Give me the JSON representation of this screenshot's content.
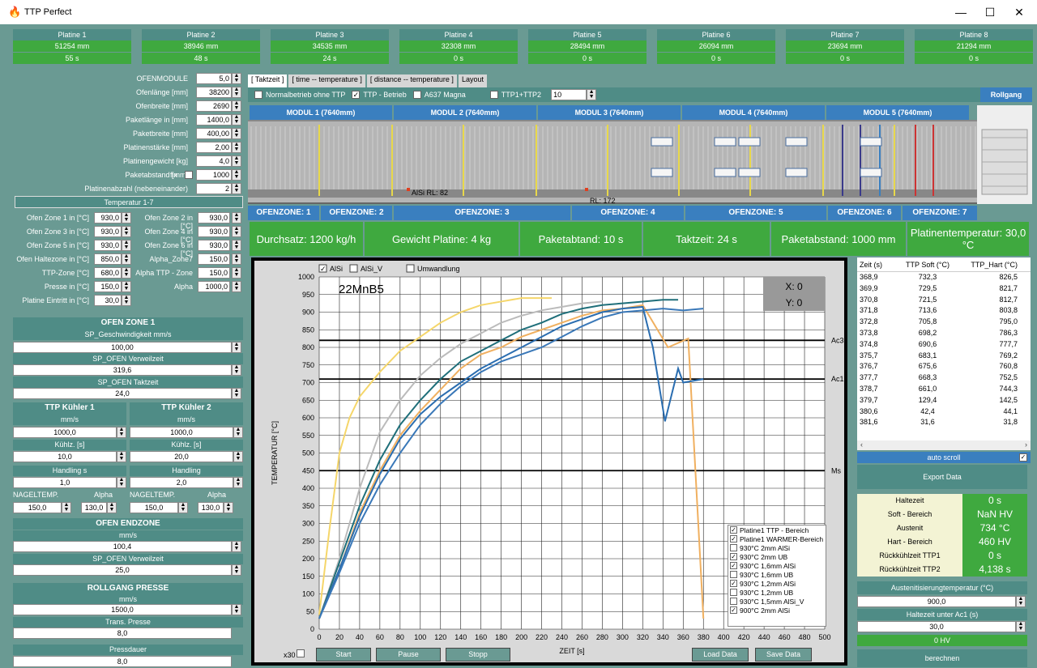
{
  "window": {
    "title": "TTP Perfect",
    "minimize": "—",
    "maximize": "☐",
    "close": "✕"
  },
  "platinen": [
    {
      "name": "Platine 1",
      "mm": "51254 mm",
      "s": "55 s"
    },
    {
      "name": "Platine 2",
      "mm": "38946 mm",
      "s": "48 s"
    },
    {
      "name": "Platine 3",
      "mm": "34535 mm",
      "s": "24 s"
    },
    {
      "name": "Platine 4",
      "mm": "32308 mm",
      "s": "0 s"
    },
    {
      "name": "Platine 5",
      "mm": "28494 mm",
      "s": "0 s"
    },
    {
      "name": "Platine 6",
      "mm": "26094 mm",
      "s": "0 s"
    },
    {
      "name": "Platine 7",
      "mm": "23694 mm",
      "s": "0 s"
    },
    {
      "name": "Platine 8",
      "mm": "21294 mm",
      "s": "0 s"
    }
  ],
  "ofen": [
    {
      "label": "OFENMODULE",
      "value": "5,0"
    },
    {
      "label": "Ofenlänge [mm]",
      "value": "38200"
    },
    {
      "label": "Ofenbreite [mm]",
      "value": "2690"
    },
    {
      "label": "Paketlänge in [mm]",
      "value": "1400,0"
    },
    {
      "label": "Paketbreite [mm]",
      "value": "400,00"
    },
    {
      "label": "Platinenstärke [mm]",
      "value": "2,00"
    },
    {
      "label": "Platinengewicht [kg]",
      "value": "4,0"
    },
    {
      "label": "Paketabstand [mm]",
      "value": "1000",
      "fix": "fix"
    },
    {
      "label": "Platinenabzahl (nebeneinander)",
      "value": "2"
    }
  ],
  "temperatur_hdr": "Temperatur 1-7",
  "zonen_links": [
    {
      "label": "Ofen Zone 1 in [°C]",
      "value": "930,0"
    },
    {
      "label": "Ofen Zone 3 in [°C]",
      "value": "930,0"
    },
    {
      "label": "Ofen Zone 5 in [°C]",
      "value": "930,0"
    },
    {
      "label": "Ofen Haltezone in [°C]",
      "value": "850,0"
    },
    {
      "label": "TTP-Zone [°C]",
      "value": "680,0"
    },
    {
      "label": "Presse in [°C]",
      "value": "150,0"
    },
    {
      "label": "Platine Eintritt in [°C]",
      "value": "30,0"
    }
  ],
  "zonen_rechts": [
    {
      "label": "Ofen Zone 2 in [°C]",
      "value": "930,0"
    },
    {
      "label": "Ofen Zone 4 in [°C]",
      "value": "930,0"
    },
    {
      "label": "Ofen Zone 6 in [°C]",
      "value": "930,0"
    },
    {
      "label": "Alpha_Zone7",
      "value": "150,0"
    },
    {
      "label": "Alpha TTP - Zone",
      "value": "150,0"
    },
    {
      "label": "Alpha",
      "value": "1000,0"
    }
  ],
  "ofen_zone1": {
    "title": "OFEN ZONE 1",
    "sp_geschw": "SP_Geschwindigkeit mm/s",
    "geschw": "100,00",
    "sp_verweil": "SP_OFEN Verweilzeit",
    "verweil": "319,6",
    "sp_takt": "SP_OFEN Taktzeit",
    "takt": "24,0"
  },
  "kuehler1": {
    "title": "TTP Kühler 1",
    "unit": "mm/s",
    "speed": "1000,0",
    "kuehlz_lbl": "Kühlz. [s]",
    "kuehlz": "10,0",
    "handling_lbl": "Handling s",
    "handling": "1,0"
  },
  "kuehler2": {
    "title": "TTP Kühler 2",
    "unit": "mm/s",
    "speed": "1000,0",
    "kuehlz_lbl": "Kühlz. [s]",
    "kuehlz": "20,0",
    "handling_lbl": "Handling",
    "handling": "2,0"
  },
  "nagel": {
    "nt_lbl": "NAGELTEMP.",
    "alpha_lbl": "Alpha",
    "nt1": "150,0",
    "a1": "130,0",
    "nt2": "150,0",
    "a2": "130,0"
  },
  "ofen_endzone": {
    "title": "OFEN ENDZONE",
    "unit": "mm/s",
    "speed": "100,4",
    "sp_verweil": "SP_OFEN Verweilzeit",
    "verweil": "25,0"
  },
  "rollgang_presse": {
    "title": "ROLLGANG PRESSE",
    "unit": "mm/s",
    "speed": "1500,0",
    "trans_lbl": "Trans. Presse",
    "trans": "8,0",
    "press_lbl": "Pressdauer",
    "press": "8,0"
  },
  "tabs": [
    "[ Taktzeit ]",
    "[ time -- temperature ]",
    "[ distance -- temperature ]",
    "Layout"
  ],
  "opts": {
    "normal": "Normalbetrieb ohne TTP",
    "ttp": "TTP - Betrieb",
    "a637": "A637 Magna",
    "ttp12": "TTP1+TTP2",
    "count": "10",
    "rollgang": "Rollgang"
  },
  "module": [
    "MODUL 1 (7640mm)",
    "MODUL 2 (7640mm)",
    "MODUL 3 (7640mm)",
    "MODUL 4 (7640mm)",
    "MODUL 5 (7640mm)"
  ],
  "markers": {
    "alsi": "AlSi RL: 82",
    "rl": "RL: 172"
  },
  "zones": [
    "OFENZONE: 1",
    "OFENZONE: 2",
    "OFENZONE: 3",
    "OFENZONE: 4",
    "OFENZONE: 5",
    "OFENZONE: 6",
    "OFENZONE: 7"
  ],
  "kpi": [
    "Durchsatz: 1200 kg/h",
    "Gewicht Platine: 4 kg",
    "Paketabtand: 10 s",
    "Taktzeit: 24 s",
    "Paketabstand: 1000 mm",
    "Platinentemperatur: 30,0 °C"
  ],
  "chart_data": {
    "type": "line",
    "title": "22MnB5",
    "xlabel": "ZEIT [s]",
    "ylabel": "TEMPERATUR [°C]",
    "xlim": [
      0,
      500
    ],
    "ylim": [
      0,
      1000
    ],
    "xticks": [
      0,
      20,
      40,
      60,
      80,
      100,
      120,
      140,
      160,
      180,
      200,
      220,
      240,
      260,
      280,
      300,
      320,
      340,
      360,
      380,
      400,
      420,
      440,
      460,
      480,
      500
    ],
    "yticks": [
      0,
      50,
      100,
      150,
      200,
      250,
      300,
      350,
      400,
      450,
      500,
      550,
      600,
      650,
      700,
      750,
      800,
      850,
      900,
      950,
      1000
    ],
    "hlines": [
      {
        "label": "Ac3",
        "y": 820
      },
      {
        "label": "Ac1",
        "y": 710
      },
      {
        "label": "Ms",
        "y": 450
      }
    ],
    "readout": {
      "x": "X: 0",
      "y": "Y: 0"
    },
    "top_checks": [
      {
        "label": "AlSi",
        "checked": true
      },
      {
        "label": "AlSi_V",
        "checked": false
      },
      {
        "label": "Umwandlung",
        "checked": false
      }
    ],
    "series": [
      {
        "name": "930°C 2mm UB",
        "color": "#f5d66a",
        "x": [
          0,
          10,
          20,
          30,
          40,
          60,
          80,
          100,
          120,
          140,
          160,
          180,
          200,
          220,
          230
        ],
        "values": [
          40,
          280,
          500,
          600,
          660,
          730,
          790,
          830,
          870,
          900,
          920,
          930,
          940,
          940,
          940
        ]
      },
      {
        "name": "930°C 2mm AlSi",
        "color": "#bbbbbb",
        "x": [
          0,
          20,
          40,
          60,
          80,
          100,
          120,
          140,
          160,
          180,
          200,
          220,
          240,
          260,
          280
        ],
        "values": [
          30,
          200,
          400,
          560,
          650,
          720,
          770,
          810,
          840,
          870,
          890,
          905,
          915,
          925,
          930
        ]
      },
      {
        "name": "930°C 1,6mm AlSi",
        "color": "#1f6f7a",
        "x": [
          0,
          20,
          40,
          60,
          80,
          100,
          120,
          140,
          160,
          180,
          200,
          220,
          240,
          260,
          280,
          300,
          320,
          340,
          355
        ],
        "values": [
          30,
          190,
          350,
          480,
          580,
          650,
          710,
          760,
          790,
          820,
          850,
          870,
          895,
          910,
          920,
          925,
          930,
          935,
          935
        ]
      },
      {
        "name": "930°C 1,2mm AlSi",
        "color": "#f0b060",
        "x": [
          0,
          20,
          40,
          60,
          80,
          100,
          120,
          140,
          160,
          180,
          200,
          220,
          240,
          260,
          280,
          300,
          320,
          345,
          365,
          380
        ],
        "values": [
          30,
          170,
          330,
          450,
          550,
          620,
          680,
          740,
          780,
          800,
          830,
          850,
          870,
          890,
          905,
          910,
          920,
          800,
          825,
          30
        ]
      },
      {
        "name": "930°C 1,5mm AlSi_V",
        "color": "#2a6db0",
        "x": [
          0,
          20,
          40,
          60,
          80,
          100,
          120,
          140,
          160,
          180,
          200,
          220,
          240,
          260,
          280,
          300,
          320,
          330,
          342,
          355,
          360,
          380
        ],
        "values": [
          30,
          170,
          320,
          440,
          540,
          610,
          660,
          700,
          740,
          770,
          800,
          830,
          860,
          880,
          900,
          910,
          915,
          800,
          590,
          740,
          700,
          710
        ]
      },
      {
        "name": "900°C 2mm AlSi",
        "color": "#3a78b8",
        "x": [
          0,
          20,
          40,
          60,
          80,
          100,
          120,
          140,
          160,
          180,
          200,
          220,
          240,
          260,
          280,
          300,
          320,
          340,
          360,
          380
        ],
        "values": [
          30,
          160,
          300,
          410,
          500,
          580,
          640,
          690,
          730,
          760,
          780,
          800,
          830,
          860,
          885,
          900,
          905,
          910,
          905,
          910
        ]
      }
    ],
    "legend": [
      {
        "label": "Platine1 TTP - Bereich",
        "checked": true
      },
      {
        "label": "Platine1 WARMER-Bereich",
        "checked": true
      },
      {
        "label": "930°C 2mm AlSi",
        "checked": false
      },
      {
        "label": "930°C 2mm UB",
        "checked": true
      },
      {
        "label": "930°C 1,6mm AlSi",
        "checked": true
      },
      {
        "label": "930°C 1,6mm UB",
        "checked": false
      },
      {
        "label": "930°C 1,2mm AlSi",
        "checked": true
      },
      {
        "label": "930°C 1,2mm UB",
        "checked": false
      },
      {
        "label": "930°C 1,5mm AlSi_V",
        "checked": false
      },
      {
        "label": "900°C 2mm AlSi",
        "checked": true
      }
    ]
  },
  "chart_buttons": {
    "x30": "x30",
    "start": "Start",
    "pause": "Pause",
    "stopp": "Stopp",
    "load": "Load Data",
    "save": "Save Data"
  },
  "table": {
    "headers": [
      "Zeit (s)",
      "TTP Soft (°C)",
      "TTP_Hart (°C)"
    ],
    "rows": [
      [
        "368,9",
        "732,3",
        "826,5"
      ],
      [
        "369,9",
        "729,5",
        "821,7"
      ],
      [
        "370,8",
        "721,5",
        "812,7"
      ],
      [
        "371,8",
        "713,6",
        "803,8"
      ],
      [
        "372,8",
        "705,8",
        "795,0"
      ],
      [
        "373,8",
        "698,2",
        "786,3"
      ],
      [
        "374,8",
        "690,6",
        "777,7"
      ],
      [
        "375,7",
        "683,1",
        "769,2"
      ],
      [
        "376,7",
        "675,6",
        "760,8"
      ],
      [
        "377,7",
        "668,3",
        "752,5"
      ],
      [
        "378,7",
        "661,0",
        "744,3"
      ],
      [
        "379,7",
        "129,4",
        "142,5"
      ],
      [
        "380,6",
        "42,4",
        "44,1"
      ],
      [
        "381,6",
        "31,6",
        "31,8"
      ]
    ]
  },
  "autoscroll": "auto scroll",
  "export": "Export Data",
  "stats": [
    {
      "label": "Haltezeit",
      "value": "0 s"
    },
    {
      "label": "Soft  - Bereich",
      "value": "NaN HV"
    },
    {
      "label": "Austenit",
      "value": "734 °C"
    },
    {
      "label": "Hart - Bereich",
      "value": "460 HV"
    },
    {
      "label": "Rückkühlzeit TTP1",
      "value": "0 s"
    },
    {
      "label": "Rückkühlzeit TTP2",
      "value": "4,138 s"
    }
  ],
  "aust": {
    "lbl": "Austenitisierungtemperatur  (°C)",
    "val": "900,0",
    "halte_lbl": "Haltezeit unter Ac1 (s)",
    "halte": "30,0",
    "hv": "0 HV",
    "btn": "berechnen"
  }
}
